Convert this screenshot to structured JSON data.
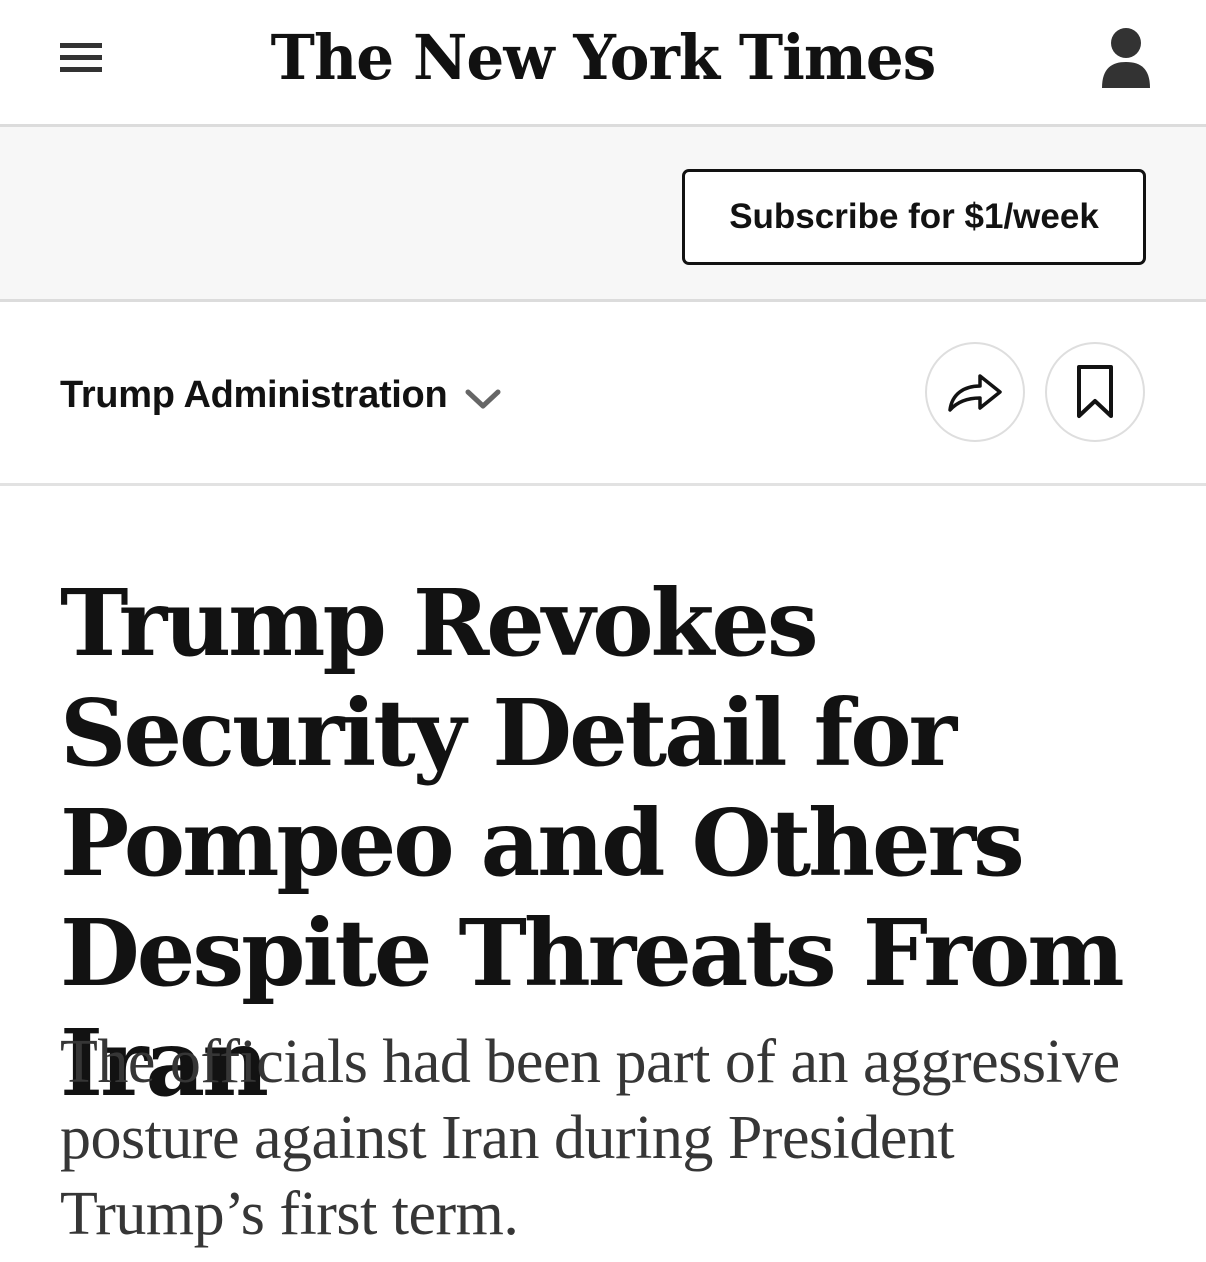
{
  "masthead": {
    "logo_text": "The New York Times",
    "menu_icon": "hamburger-menu-icon",
    "account_icon": "user-account-icon"
  },
  "subscribe": {
    "button_label": "Subscribe for $1/week"
  },
  "section": {
    "label": "Trump Administration",
    "dropdown_icon": "chevron-down-icon",
    "share_icon": "share-arrow-icon",
    "bookmark_icon": "bookmark-icon"
  },
  "article": {
    "headline": "Trump Revokes Security Detail for Pompeo and Others Despite Threats From Iran",
    "summary": "The officials had been part of an aggressive posture against Iran during President Trump’s first term."
  },
  "colors": {
    "text": "#121212",
    "summary_text": "#363636",
    "subscribe_bar_bg": "#f7f7f7",
    "divider": "#dcdcdc"
  }
}
